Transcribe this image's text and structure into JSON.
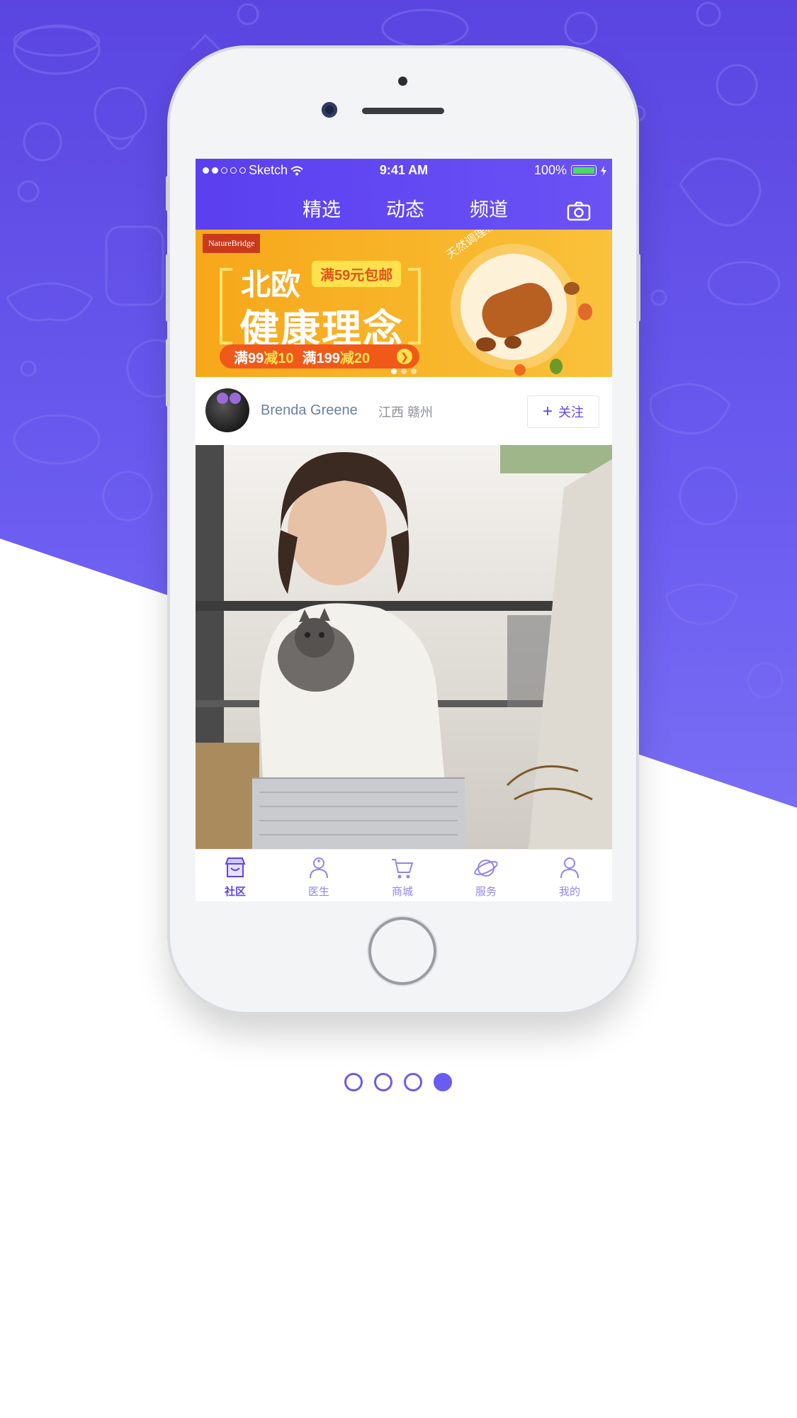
{
  "status_bar": {
    "carrier": "Sketch",
    "time": "9:41 AM",
    "battery": "100%"
  },
  "header": {
    "tabs": [
      {
        "label": "精选",
        "active": true
      },
      {
        "label": "动态",
        "active": false
      },
      {
        "label": "频道",
        "active": false
      }
    ],
    "camera_icon": "camera-icon"
  },
  "banner": {
    "brand": "NatureBridge",
    "title_line1": "北欧",
    "badge": "满59元包邮",
    "title_line2": "健康理念",
    "offer_a": "满99",
    "offer_a_off": "减10",
    "offer_b": "满199",
    "offer_b_off": "减20",
    "tagline": "天然调理相伴更久",
    "slides": 3,
    "active_slide": 1
  },
  "post": {
    "user_name": "Brenda Greene",
    "location": "江西 赣州",
    "follow_label": "关注"
  },
  "tabbar": {
    "items": [
      {
        "label": "社区",
        "icon": "store-icon",
        "active": true
      },
      {
        "label": "医生",
        "icon": "doctor-icon",
        "active": false
      },
      {
        "label": "商城",
        "icon": "cart-icon",
        "active": false
      },
      {
        "label": "服务",
        "icon": "planet-icon",
        "active": false
      },
      {
        "label": "我的",
        "icon": "user-icon",
        "active": false
      }
    ]
  },
  "page_indicator": {
    "count": 4,
    "active": 4
  },
  "colors": {
    "brand_purple": "#5d45e8",
    "banner_orange": "#f7a71a",
    "offer_red": "#ef5a1a",
    "highlight_yellow": "#ffe14d"
  }
}
